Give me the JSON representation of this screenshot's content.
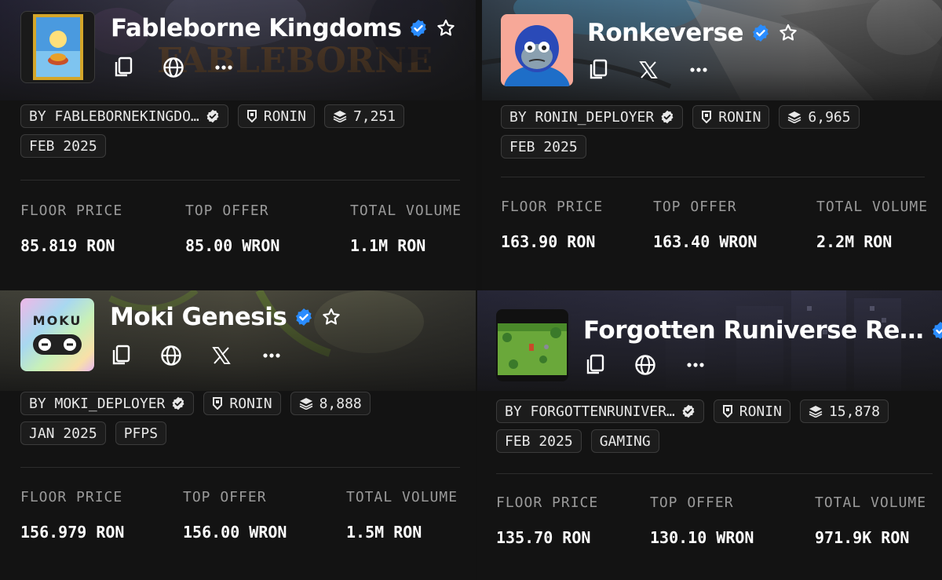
{
  "cards": [
    {
      "title": "Fableborne Kingdoms",
      "creator": "BY FABLEBORNEKINGDO…",
      "chain": "RONIN",
      "items": "7,251",
      "tags": [
        "FEB 2025"
      ],
      "stats": [
        {
          "label": "FLOOR PRICE",
          "value": "85.819 RON"
        },
        {
          "label": "TOP OFFER",
          "value": "85.00 WRON"
        },
        {
          "label": "TOTAL VOLUME",
          "value": "1.1M RON"
        }
      ],
      "links": [
        "copy-icon",
        "globe-icon",
        "more-icon"
      ]
    },
    {
      "title": "Ronkeverse",
      "creator": "BY RONIN_DEPLOYER",
      "chain": "RONIN",
      "items": "6,965",
      "tags": [
        "FEB 2025"
      ],
      "stats": [
        {
          "label": "FLOOR PRICE",
          "value": "163.90 RON"
        },
        {
          "label": "TOP OFFER",
          "value": "163.40 WRON"
        },
        {
          "label": "TOTAL VOLUME",
          "value": "2.2M RON"
        }
      ],
      "links": [
        "copy-icon",
        "x-icon",
        "more-icon"
      ]
    },
    {
      "title": "Moki Genesis",
      "creator": "BY MOKI_DEPLOYER",
      "chain": "RONIN",
      "items": "8,888",
      "tags": [
        "JAN 2025",
        "PFPS"
      ],
      "stats": [
        {
          "label": "FLOOR PRICE",
          "value": "156.979 RON"
        },
        {
          "label": "TOP OFFER",
          "value": "156.00 WRON"
        },
        {
          "label": "TOTAL VOLUME",
          "value": "1.5M RON"
        }
      ],
      "links": [
        "copy-icon",
        "globe-icon",
        "x-icon",
        "more-icon"
      ]
    },
    {
      "title": "Forgotten Runiverse Re…",
      "creator": "BY FORGOTTENRUNIVER…",
      "chain": "RONIN",
      "items": "15,878",
      "tags": [
        "FEB 2025",
        "GAMING"
      ],
      "stats": [
        {
          "label": "FLOOR PRICE",
          "value": "135.70 RON"
        },
        {
          "label": "TOP OFFER",
          "value": "130.10 WRON"
        },
        {
          "label": "TOTAL VOLUME",
          "value": "971.9K RON"
        }
      ],
      "links": [
        "copy-icon",
        "globe-icon",
        "more-icon"
      ]
    }
  ],
  "colors": {
    "background": "#121212",
    "verified": "#2a8cff",
    "chip_border": "#3b3b3b",
    "label": "#9a9a9a"
  }
}
